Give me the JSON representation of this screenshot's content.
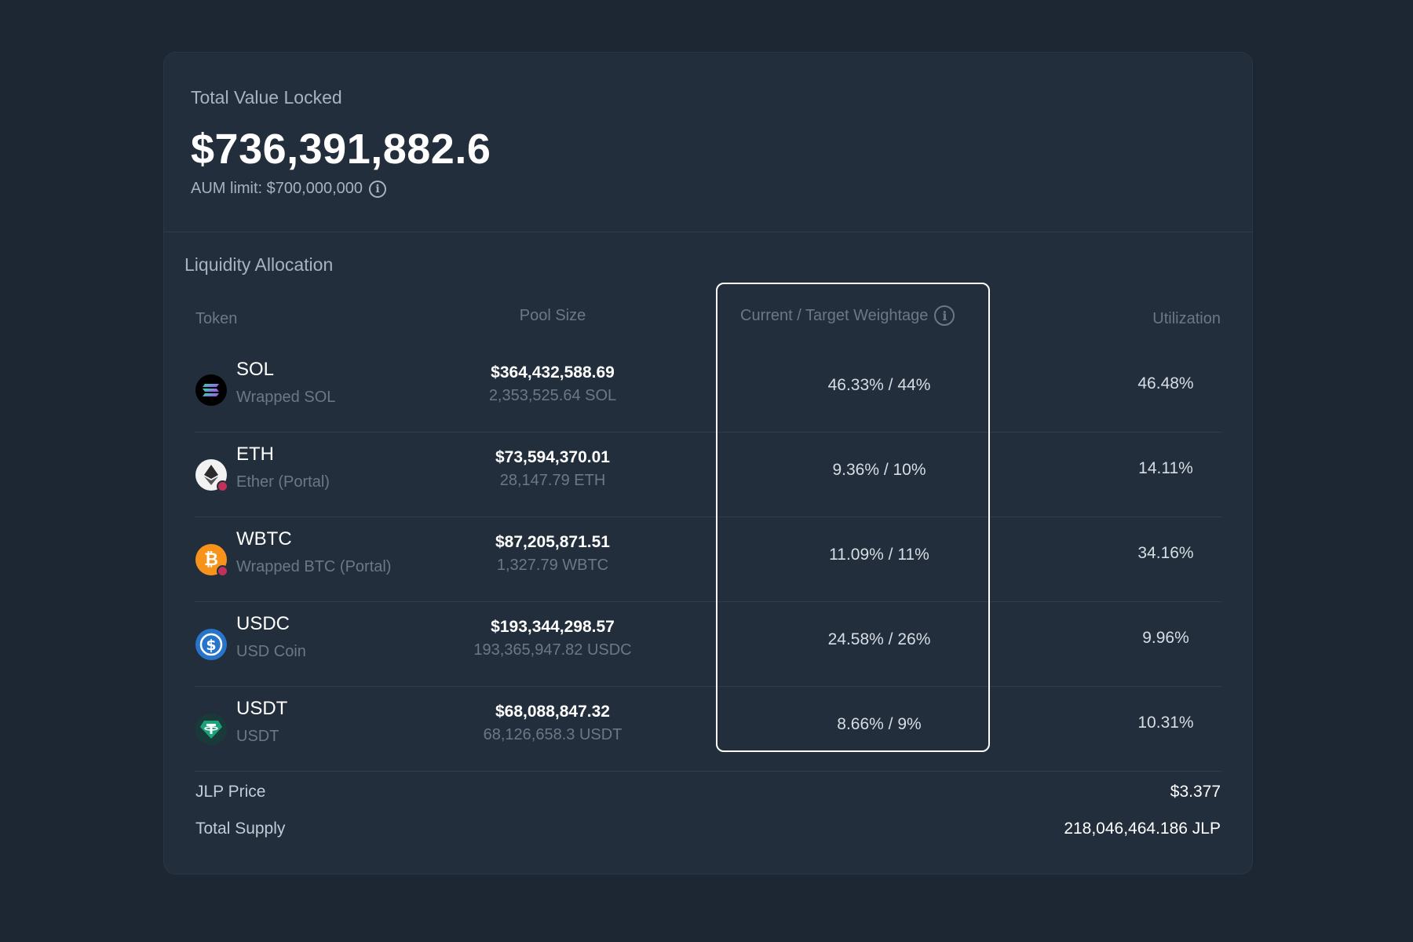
{
  "tvl": {
    "label": "Total Value Locked",
    "value": "$736,391,882.6",
    "aum_limit": "AUM limit: $700,000,000"
  },
  "allocation": {
    "title": "Liquidity Allocation",
    "headers": {
      "token": "Token",
      "pool_size": "Pool Size",
      "weightage": "Current / Target Weightage",
      "utilization": "Utilization"
    },
    "rows": [
      {
        "symbol": "SOL",
        "name": "Wrapped SOL",
        "icon": "sol-icon",
        "icon_color": "#000000",
        "pool_usd": "$364,432,588.69",
        "pool_amount": "2,353,525.64 SOL",
        "weightage": "46.33% / 44%",
        "utilization": "46.48%"
      },
      {
        "symbol": "ETH",
        "name": "Ether (Portal)",
        "icon": "eth-icon",
        "icon_color": "#ffffff",
        "pool_usd": "$73,594,370.01",
        "pool_amount": "28,147.79 ETH",
        "weightage": "9.36% / 10%",
        "utilization": "14.11%"
      },
      {
        "symbol": "WBTC",
        "name": "Wrapped BTC (Portal)",
        "icon": "btc-icon",
        "icon_color": "#f7931a",
        "pool_usd": "$87,205,871.51",
        "pool_amount": "1,327.79 WBTC",
        "weightage": "11.09% / 11%",
        "utilization": "34.16%"
      },
      {
        "symbol": "USDC",
        "name": "USD Coin",
        "icon": "usdc-icon",
        "icon_color": "#2775ca",
        "pool_usd": "$193,344,298.57",
        "pool_amount": "193,365,947.82 USDC",
        "weightage": "24.58% / 26%",
        "utilization": "9.96%"
      },
      {
        "symbol": "USDT",
        "name": "USDT",
        "icon": "usdt-icon",
        "icon_color": "#1ba27a",
        "pool_usd": "$68,088,847.32",
        "pool_amount": "68,126,658.3 USDT",
        "weightage": "8.66% / 9%",
        "utilization": "10.31%"
      }
    ]
  },
  "footer": {
    "jlp_price_label": "JLP Price",
    "jlp_price_value": "$3.377",
    "total_supply_label": "Total Supply",
    "total_supply_value": "218,046,464.186 JLP"
  },
  "colors": {
    "background": "#1c2733",
    "card": "#222e3b",
    "highlight_border": "#ffffff"
  }
}
